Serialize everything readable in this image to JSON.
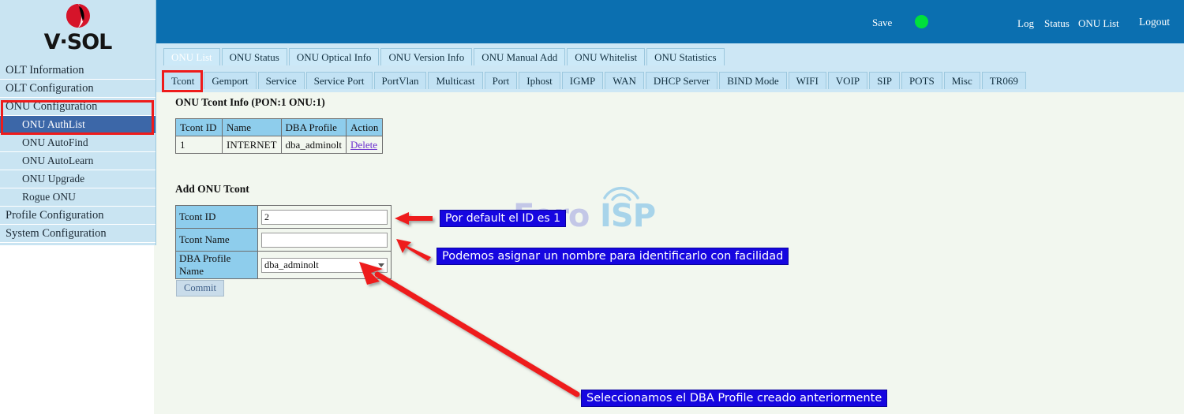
{
  "brand": {
    "logo_icon": "vsol-circle-logo",
    "wordmark": "V·SOL"
  },
  "sidebar": {
    "items": [
      {
        "label": "OLT Information",
        "level": "top",
        "active": false
      },
      {
        "label": "OLT Configuration",
        "level": "top",
        "active": false
      },
      {
        "label": "ONU Configuration",
        "level": "top",
        "active": false
      },
      {
        "label": "ONU AuthList",
        "level": "sub",
        "active": true
      },
      {
        "label": "ONU AutoFind",
        "level": "sub",
        "active": false
      },
      {
        "label": "ONU AutoLearn",
        "level": "sub",
        "active": false
      },
      {
        "label": "ONU Upgrade",
        "level": "sub",
        "active": false
      },
      {
        "label": "Rogue ONU",
        "level": "sub",
        "active": false
      },
      {
        "label": "Profile Configuration",
        "level": "top",
        "active": false
      },
      {
        "label": "System Configuration",
        "level": "top",
        "active": false
      }
    ]
  },
  "header": {
    "save_label": "Save",
    "status_dot_color": "#00e03c",
    "links": [
      "Log",
      "Status",
      "ONU List",
      "Logout"
    ],
    "log_label": "Log",
    "status_label": "Status",
    "onu_list_label": "ONU List",
    "logout_label": "Logout",
    "background_color": "#0b6fb0"
  },
  "tabs_primary": {
    "items": [
      {
        "label": "ONU List",
        "active": true
      },
      {
        "label": "ONU Status",
        "active": false
      },
      {
        "label": "ONU Optical Info",
        "active": false
      },
      {
        "label": "ONU Version Info",
        "active": false
      },
      {
        "label": "ONU Manual Add",
        "active": false
      },
      {
        "label": "ONU Whitelist",
        "active": false
      },
      {
        "label": "ONU Statistics",
        "active": false
      }
    ]
  },
  "tabs_secondary": {
    "items": [
      {
        "label": "Tcont",
        "active": false,
        "highlighted": true
      },
      {
        "label": "Gemport",
        "active": false
      },
      {
        "label": "Service",
        "active": false
      },
      {
        "label": "Service Port",
        "active": false
      },
      {
        "label": "PortVlan",
        "active": false
      },
      {
        "label": "Multicast",
        "active": false
      },
      {
        "label": "Port",
        "active": false
      },
      {
        "label": "Iphost",
        "active": false
      },
      {
        "label": "IGMP",
        "active": false
      },
      {
        "label": "WAN",
        "active": false
      },
      {
        "label": "DHCP Server",
        "active": false
      },
      {
        "label": "BIND Mode",
        "active": false
      },
      {
        "label": "WIFI",
        "active": false
      },
      {
        "label": "VOIP",
        "active": false
      },
      {
        "label": "SIP",
        "active": false
      },
      {
        "label": "POTS",
        "active": false
      },
      {
        "label": "Misc",
        "active": false
      },
      {
        "label": "TR069",
        "active": false
      }
    ]
  },
  "main": {
    "info_section": {
      "title": "ONU Tcont Info (PON:1 ONU:1)",
      "columns": [
        "Tcont ID",
        "Name",
        "DBA Profile",
        "Action"
      ],
      "rows": [
        {
          "tcont_id": "1",
          "name": "INTERNET",
          "dba_profile": "dba_adminolt",
          "action": "Delete"
        }
      ]
    },
    "add_section": {
      "title": "Add ONU Tcont",
      "fields": [
        {
          "label": "Tcont ID",
          "value": "2",
          "type": "text",
          "placeholder": ""
        },
        {
          "label": "Tcont Name",
          "value": "",
          "type": "text",
          "placeholder": ""
        },
        {
          "label": "DBA Profile Name",
          "value": "dba_adminolt",
          "type": "select",
          "placeholder": ""
        }
      ],
      "field_tcont_id_label": "Tcont ID",
      "field_tcont_id_value": "2",
      "field_tcont_name_label": "Tcont Name",
      "field_tcont_name_value": "",
      "field_dba_label": "DBA Profile Name",
      "field_dba_value": "dba_adminolt",
      "commit_label": "Commit"
    }
  },
  "watermark": {
    "text_left": "Foro",
    "text_right": "ISP",
    "icon": "wifi-arc-icon"
  },
  "annotations": {
    "callouts": [
      {
        "text": "Por default el ID es 1"
      },
      {
        "text": "Podemos asignar un nombre para identificarlo con facilidad"
      },
      {
        "text": "Seleccionamos el DBA Profile creado anteriormente"
      }
    ],
    "callout_1": "Por default el ID es 1",
    "callout_2": "Podemos asignar un nombre para identificarlo con facilidad",
    "callout_3": "Seleccionamos el DBA Profile creado anteriormente",
    "highlight_color": "#ee1b1b",
    "callout_bg_color": "#1606e0"
  }
}
